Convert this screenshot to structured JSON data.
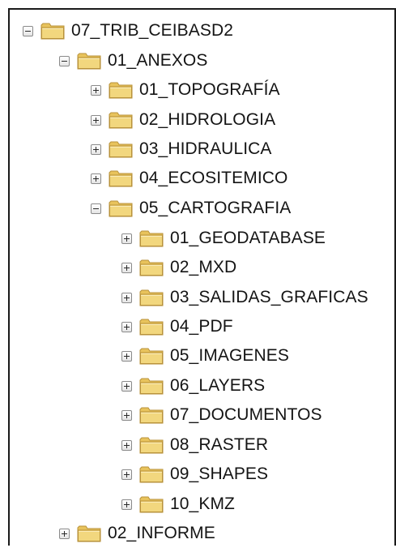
{
  "tree": {
    "root": {
      "label": "07_TRIB_CEIBASD2",
      "expanded": true,
      "toggle_icon": "minus-icon"
    },
    "anexos": {
      "label": "01_ANEXOS",
      "expanded": true,
      "toggle_icon": "minus-icon"
    },
    "anexos_children": [
      {
        "label": "01_TOPOGRAFÍA",
        "expanded": false
      },
      {
        "label": "02_HIDROLOGIA",
        "expanded": false
      },
      {
        "label": "03_HIDRAULICA",
        "expanded": false
      },
      {
        "label": "04_ECOSITEMICO",
        "expanded": false
      },
      {
        "label": "05_CARTOGRAFIA",
        "expanded": true
      }
    ],
    "cartografia_children": [
      {
        "label": "01_GEODATABASE",
        "expanded": false
      },
      {
        "label": "02_MXD",
        "expanded": false
      },
      {
        "label": "03_SALIDAS_GRAFICAS",
        "expanded": false
      },
      {
        "label": "04_PDF",
        "expanded": false
      },
      {
        "label": "05_IMAGENES",
        "expanded": false
      },
      {
        "label": "06_LAYERS",
        "expanded": false
      },
      {
        "label": "07_DOCUMENTOS",
        "expanded": false
      },
      {
        "label": "08_RASTER",
        "expanded": false
      },
      {
        "label": "09_SHAPES",
        "expanded": false
      },
      {
        "label": "10_KMZ",
        "expanded": false
      }
    ],
    "informe": {
      "label": "02_INFORME",
      "expanded": false,
      "toggle_icon": "plus-icon"
    }
  },
  "colors": {
    "folder_body": "#f2d77e",
    "folder_edge": "#b8923a",
    "folder_tab": "#e8c35c",
    "border": "#1a1a1a"
  }
}
